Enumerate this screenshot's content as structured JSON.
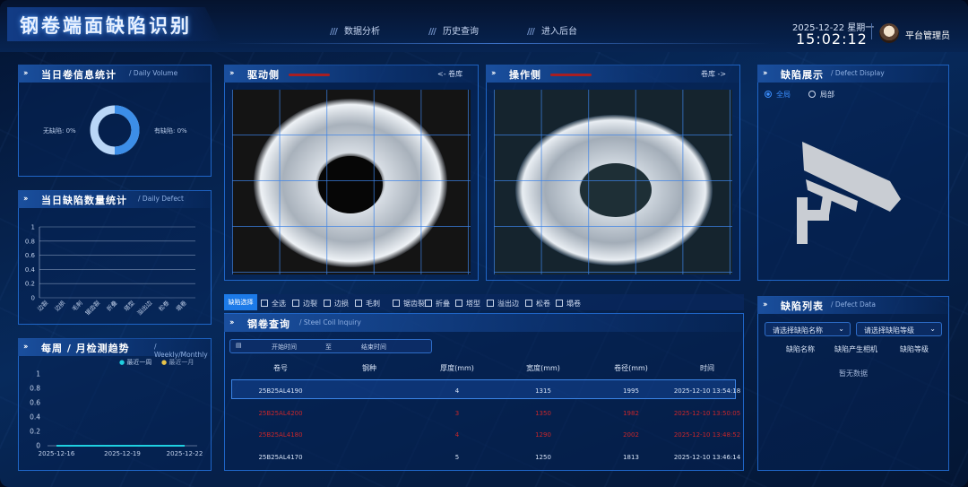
{
  "header": {
    "title": "钢卷端面缺陷识别",
    "nav": [
      "数据分析",
      "历史查询",
      "进入后台"
    ],
    "date": "2025-12-22 星期一",
    "time": "15:02:12",
    "user": "平台管理员"
  },
  "daily_volume": {
    "title": "当日卷信息统计",
    "subtitle": "Daily Volume",
    "no_defect": "无缺陷: 0%",
    "has_defect": "有缺陷: 0%"
  },
  "daily_defect": {
    "title": "当日缺陷数量统计",
    "subtitle": "Daily Defect",
    "y_ticks": [
      "1",
      "0.8",
      "0.6",
      "0.4",
      "0.2",
      "0"
    ],
    "categories": [
      "边裂",
      "边损",
      "毛刺",
      "锯齿裂",
      "折叠",
      "塔型",
      "溢出边",
      "松卷",
      "塌卷"
    ]
  },
  "weekly": {
    "title": "每周 / 月检测趋势",
    "subtitle": "Weekly/Monthly",
    "legend": [
      "最近一周",
      "最近一月"
    ],
    "y_ticks": [
      "1",
      "0.8",
      "0.6",
      "0.4",
      "0.2",
      "0"
    ],
    "x_ticks": [
      "2025-12-16",
      "2025-12-19",
      "2025-12-22"
    ]
  },
  "drive_side": {
    "title": "驱动侧",
    "link": "卷库"
  },
  "operate_side": {
    "title": "操作侧",
    "link": "卷库"
  },
  "defect_filter": {
    "tag": "缺陷选择",
    "options": [
      "全选",
      "边裂",
      "边损",
      "毛刺",
      "锯齿裂",
      "折叠",
      "塔型",
      "溢出边",
      "松卷",
      "塌卷"
    ]
  },
  "coil_query": {
    "title": "钢卷查询",
    "subtitle": "Steel Coil Inquiry",
    "start": "开始时间",
    "to": "至",
    "end": "结束时间",
    "columns": [
      "卷号",
      "钢种",
      "厚度(mm)",
      "宽度(mm)",
      "卷径(mm)",
      "时间"
    ],
    "rows": [
      [
        "25B25AL4190",
        "",
        "4",
        "1315",
        "1995",
        "2025-12-10 13:54:18"
      ],
      [
        "25B25AL4200",
        "",
        "3",
        "1350",
        "1982",
        "2025-12-10 13:50:05"
      ],
      [
        "25B25AL4180",
        "",
        "4",
        "1290",
        "2002",
        "2025-12-10 13:48:52"
      ],
      [
        "25B25AL4170",
        "",
        "5",
        "1250",
        "1813",
        "2025-12-10 13:46:14"
      ]
    ]
  },
  "defect_display": {
    "title": "缺陷展示",
    "subtitle": "Defect Display",
    "options": [
      "全局",
      "局部"
    ]
  },
  "defect_list": {
    "title": "缺陷列表",
    "subtitle": "Defect Data",
    "select_name": "请选择缺陷名称",
    "select_level": "请选择缺陷等级",
    "columns": [
      "缺陷名称",
      "缺陷产生相机",
      "缺陷等级"
    ],
    "empty": "暂无数据"
  },
  "colors": {
    "accent": "#1c7ae8",
    "alert": "#c8262a",
    "legend_week": "#1fd0e0",
    "legend_month": "#e8c44a"
  }
}
